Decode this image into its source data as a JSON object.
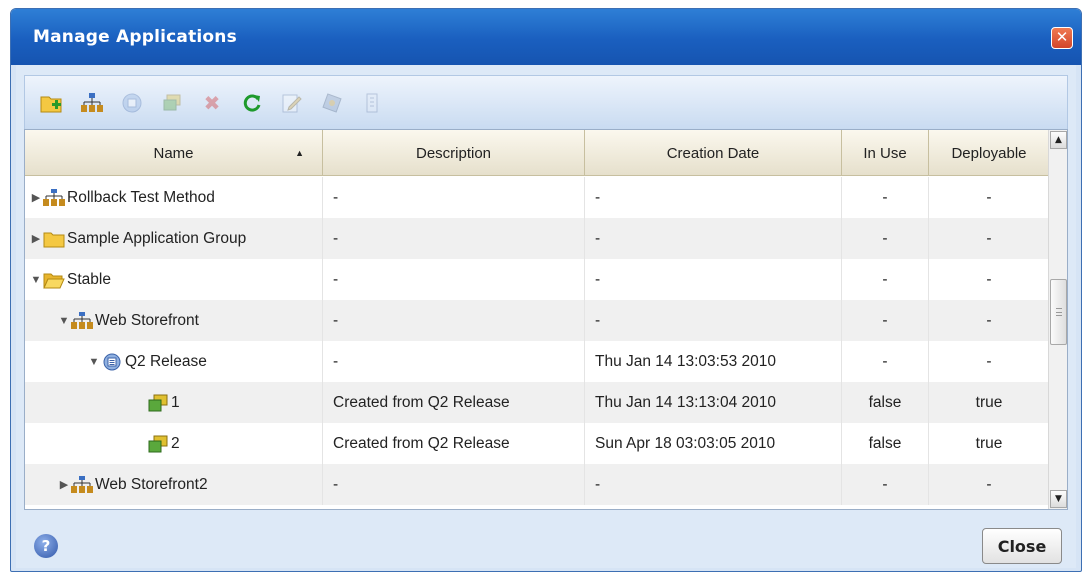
{
  "window": {
    "title": "Manage Applications",
    "close_glyph": "✕"
  },
  "toolbar": {
    "buttons": [
      {
        "icon": "new-folder-icon",
        "enabled": true
      },
      {
        "icon": "new-application-icon",
        "enabled": true
      },
      {
        "icon": "new-release-icon",
        "enabled": false
      },
      {
        "icon": "new-snapshot-icon",
        "enabled": false
      },
      {
        "icon": "delete-icon",
        "enabled": false
      },
      {
        "icon": "refresh-icon",
        "enabled": true
      },
      {
        "icon": "edit-icon",
        "enabled": false
      },
      {
        "icon": "deploy-icon",
        "enabled": false
      },
      {
        "icon": "export-icon",
        "enabled": false
      }
    ]
  },
  "grid": {
    "columns": {
      "name": "Name",
      "description": "Description",
      "creation_date": "Creation Date",
      "in_use": "In Use",
      "deployable": "Deployable"
    },
    "sort_indicator": "▲",
    "rows": [
      {
        "expander": "▶",
        "icon": "application-icon",
        "name": "Rollback Test Method",
        "description": "-",
        "creation_date": "-",
        "in_use": "-",
        "deployable": "-"
      },
      {
        "expander": "▶",
        "icon": "folder-icon",
        "name": "Sample Application Group",
        "description": "-",
        "creation_date": "-",
        "in_use": "-",
        "deployable": "-"
      },
      {
        "expander": "▼",
        "icon": "folder-open-icon",
        "name": "Stable",
        "description": "-",
        "creation_date": "-",
        "in_use": "-",
        "deployable": "-"
      },
      {
        "expander": "▼",
        "icon": "application-icon",
        "name": "Web Storefront",
        "description": "-",
        "creation_date": "-",
        "in_use": "-",
        "deployable": "-"
      },
      {
        "expander": "▼",
        "icon": "release-icon",
        "name": "Q2 Release",
        "description": "-",
        "creation_date": "Thu Jan 14 13:03:53 2010",
        "in_use": "-",
        "deployable": "-"
      },
      {
        "expander": "",
        "icon": "snapshot-icon",
        "name": "1",
        "description": "Created from Q2 Release",
        "creation_date": "Thu Jan 14 13:13:04 2010",
        "in_use": "false",
        "deployable": "true"
      },
      {
        "expander": "",
        "icon": "snapshot-icon",
        "name": "2",
        "description": "Created from Q2 Release",
        "creation_date": "Sun Apr 18 03:03:05 2010",
        "in_use": "false",
        "deployable": "true"
      },
      {
        "expander": "▶",
        "icon": "application-icon",
        "name": "Web Storefront2",
        "description": "-",
        "creation_date": "-",
        "in_use": "-",
        "deployable": "-"
      }
    ]
  },
  "footer": {
    "help_glyph": "?",
    "close_label": "Close"
  },
  "colors": {
    "title_bar": "#1a5fbf",
    "header_bg": "#e6e0cc",
    "row_alt": "#f0f0f0"
  }
}
